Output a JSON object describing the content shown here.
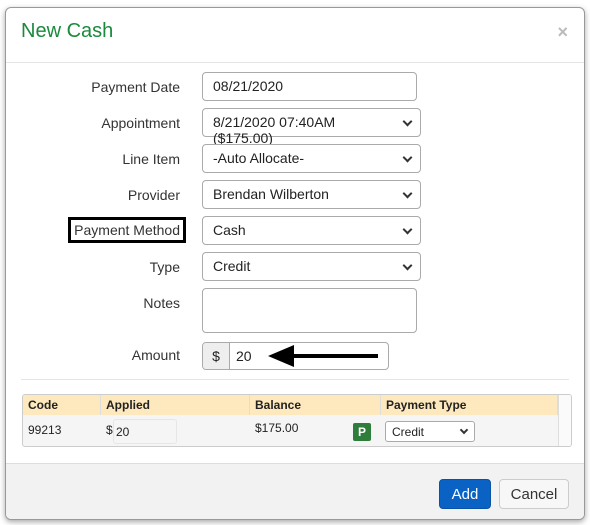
{
  "modal": {
    "title": "New Cash",
    "close": "×"
  },
  "form": {
    "payment_date": {
      "label": "Payment Date",
      "value": "08/21/2020"
    },
    "appointment": {
      "label": "Appointment",
      "value": "8/21/2020 07:40AM ($175.00)"
    },
    "line_item": {
      "label": "Line Item",
      "value": "-Auto Allocate-"
    },
    "provider": {
      "label": "Provider",
      "value": "Brendan Wilberton"
    },
    "payment_method": {
      "label": "Payment Method",
      "value": "Cash"
    },
    "type": {
      "label": "Type",
      "value": "Credit"
    },
    "notes": {
      "label": "Notes",
      "value": ""
    },
    "amount": {
      "label": "Amount",
      "prefix": "$",
      "value": "20"
    }
  },
  "table": {
    "headers": [
      "Code",
      "Applied",
      "Balance",
      "Payment Type"
    ],
    "rows": [
      {
        "code": "99213",
        "applied_prefix": "$",
        "applied": "20",
        "balance": "$175.00",
        "badge": "P",
        "payment_type": "Credit"
      }
    ]
  },
  "footer": {
    "add": "Add",
    "cancel": "Cancel"
  }
}
